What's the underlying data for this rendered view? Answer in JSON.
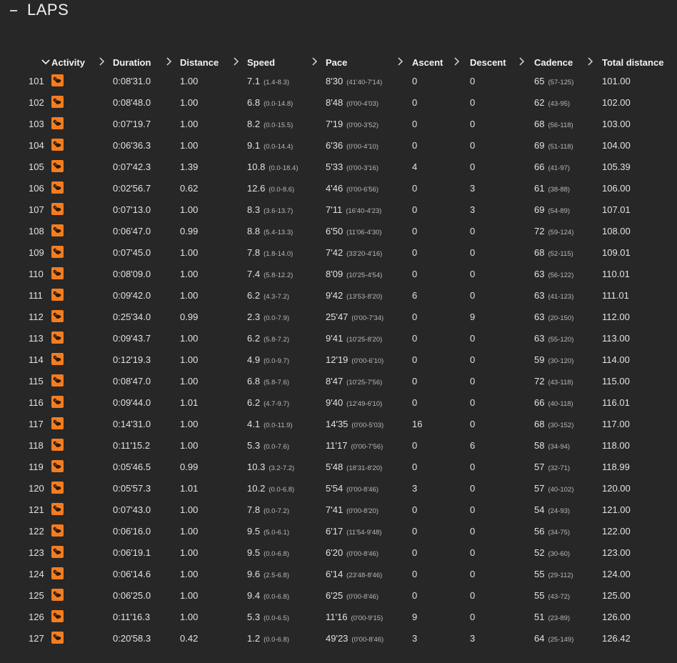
{
  "header": {
    "title": "LAPS"
  },
  "columns": [
    "Activity",
    "Duration",
    "Distance",
    "Speed",
    "Pace",
    "Ascent",
    "Descent",
    "Cadence",
    "Total distance"
  ],
  "laps": [
    {
      "n": "101",
      "dur": "0:08'31.0",
      "dist": "1.00",
      "spd": "7.1",
      "spd_r": "(1.4-8.3)",
      "pace": "8'30",
      "pace_r": "(41'40-7'14)",
      "asc": "0",
      "desc": "0",
      "cad": "65",
      "cad_r": "(57-125)",
      "tot": "101.00"
    },
    {
      "n": "102",
      "dur": "0:08'48.0",
      "dist": "1.00",
      "spd": "6.8",
      "spd_r": "(0.0-14.8)",
      "pace": "8'48",
      "pace_r": "(0'00-4'03)",
      "asc": "0",
      "desc": "0",
      "cad": "62",
      "cad_r": "(43-95)",
      "tot": "102.00"
    },
    {
      "n": "103",
      "dur": "0:07'19.7",
      "dist": "1.00",
      "spd": "8.2",
      "spd_r": "(0.0-15.5)",
      "pace": "7'19",
      "pace_r": "(0'00-3'52)",
      "asc": "0",
      "desc": "0",
      "cad": "68",
      "cad_r": "(56-118)",
      "tot": "103.00"
    },
    {
      "n": "104",
      "dur": "0:06'36.3",
      "dist": "1.00",
      "spd": "9.1",
      "spd_r": "(0.0-14.4)",
      "pace": "6'36",
      "pace_r": "(0'00-4'10)",
      "asc": "0",
      "desc": "0",
      "cad": "69",
      "cad_r": "(51-118)",
      "tot": "104.00"
    },
    {
      "n": "105",
      "dur": "0:07'42.3",
      "dist": "1.39",
      "spd": "10.8",
      "spd_r": "(0.0-18.4)",
      "pace": "5'33",
      "pace_r": "(0'00-3'16)",
      "asc": "4",
      "desc": "0",
      "cad": "66",
      "cad_r": "(41-97)",
      "tot": "105.39"
    },
    {
      "n": "106",
      "dur": "0:02'56.7",
      "dist": "0.62",
      "spd": "12.6",
      "spd_r": "(0.0-8.6)",
      "pace": "4'46",
      "pace_r": "(0'00-6'56)",
      "asc": "0",
      "desc": "3",
      "cad": "61",
      "cad_r": "(38-88)",
      "tot": "106.00"
    },
    {
      "n": "107",
      "dur": "0:07'13.0",
      "dist": "1.00",
      "spd": "8.3",
      "spd_r": "(3.6-13.7)",
      "pace": "7'11",
      "pace_r": "(16'40-4'23)",
      "asc": "0",
      "desc": "3",
      "cad": "69",
      "cad_r": "(54-89)",
      "tot": "107.01"
    },
    {
      "n": "108",
      "dur": "0:06'47.0",
      "dist": "0.99",
      "spd": "8.8",
      "spd_r": "(5.4-13.3)",
      "pace": "6'50",
      "pace_r": "(11'06-4'30)",
      "asc": "0",
      "desc": "0",
      "cad": "72",
      "cad_r": "(59-124)",
      "tot": "108.00"
    },
    {
      "n": "109",
      "dur": "0:07'45.0",
      "dist": "1.00",
      "spd": "7.8",
      "spd_r": "(1.8-14.0)",
      "pace": "7'42",
      "pace_r": "(33'20-4'16)",
      "asc": "0",
      "desc": "0",
      "cad": "68",
      "cad_r": "(52-115)",
      "tot": "109.01"
    },
    {
      "n": "110",
      "dur": "0:08'09.0",
      "dist": "1.00",
      "spd": "7.4",
      "spd_r": "(5.8-12.2)",
      "pace": "8'09",
      "pace_r": "(10'25-4'54)",
      "asc": "0",
      "desc": "0",
      "cad": "63",
      "cad_r": "(56-122)",
      "tot": "110.01"
    },
    {
      "n": "111",
      "dur": "0:09'42.0",
      "dist": "1.00",
      "spd": "6.2",
      "spd_r": "(4.3-7.2)",
      "pace": "9'42",
      "pace_r": "(13'53-8'20)",
      "asc": "6",
      "desc": "0",
      "cad": "63",
      "cad_r": "(41-123)",
      "tot": "111.01"
    },
    {
      "n": "112",
      "dur": "0:25'34.0",
      "dist": "0.99",
      "spd": "2.3",
      "spd_r": "(0.0-7.9)",
      "pace": "25'47",
      "pace_r": "(0'00-7'34)",
      "asc": "0",
      "desc": "9",
      "cad": "63",
      "cad_r": "(20-150)",
      "tot": "112.00"
    },
    {
      "n": "113",
      "dur": "0:09'43.7",
      "dist": "1.00",
      "spd": "6.2",
      "spd_r": "(5.8-7.2)",
      "pace": "9'41",
      "pace_r": "(10'25-8'20)",
      "asc": "0",
      "desc": "0",
      "cad": "63",
      "cad_r": "(55-120)",
      "tot": "113.00"
    },
    {
      "n": "114",
      "dur": "0:12'19.3",
      "dist": "1.00",
      "spd": "4.9",
      "spd_r": "(0.0-9.7)",
      "pace": "12'19",
      "pace_r": "(0'00-6'10)",
      "asc": "0",
      "desc": "0",
      "cad": "59",
      "cad_r": "(30-120)",
      "tot": "114.00"
    },
    {
      "n": "115",
      "dur": "0:08'47.0",
      "dist": "1.00",
      "spd": "6.8",
      "spd_r": "(5.8-7.6)",
      "pace": "8'47",
      "pace_r": "(10'25-7'56)",
      "asc": "0",
      "desc": "0",
      "cad": "72",
      "cad_r": "(43-118)",
      "tot": "115.00"
    },
    {
      "n": "116",
      "dur": "0:09'44.0",
      "dist": "1.01",
      "spd": "6.2",
      "spd_r": "(4.7-9.7)",
      "pace": "9'40",
      "pace_r": "(12'49-6'10)",
      "asc": "0",
      "desc": "0",
      "cad": "66",
      "cad_r": "(40-118)",
      "tot": "116.01"
    },
    {
      "n": "117",
      "dur": "0:14'31.0",
      "dist": "1.00",
      "spd": "4.1",
      "spd_r": "(0.0-11.9)",
      "pace": "14'35",
      "pace_r": "(0'00-5'03)",
      "asc": "16",
      "desc": "0",
      "cad": "68",
      "cad_r": "(30-152)",
      "tot": "117.00"
    },
    {
      "n": "118",
      "dur": "0:11'15.2",
      "dist": "1.00",
      "spd": "5.3",
      "spd_r": "(0.0-7.6)",
      "pace": "11'17",
      "pace_r": "(0'00-7'56)",
      "asc": "0",
      "desc": "6",
      "cad": "58",
      "cad_r": "(34-94)",
      "tot": "118.00"
    },
    {
      "n": "119",
      "dur": "0:05'46.5",
      "dist": "0.99",
      "spd": "10.3",
      "spd_r": "(3.2-7.2)",
      "pace": "5'48",
      "pace_r": "(18'31-8'20)",
      "asc": "0",
      "desc": "0",
      "cad": "57",
      "cad_r": "(32-71)",
      "tot": "118.99"
    },
    {
      "n": "120",
      "dur": "0:05'57.3",
      "dist": "1.01",
      "spd": "10.2",
      "spd_r": "(0.0-6.8)",
      "pace": "5'54",
      "pace_r": "(0'00-8'46)",
      "asc": "3",
      "desc": "0",
      "cad": "57",
      "cad_r": "(40-102)",
      "tot": "120.00"
    },
    {
      "n": "121",
      "dur": "0:07'43.0",
      "dist": "1.00",
      "spd": "7.8",
      "spd_r": "(0.0-7.2)",
      "pace": "7'41",
      "pace_r": "(0'00-8'20)",
      "asc": "0",
      "desc": "0",
      "cad": "54",
      "cad_r": "(24-93)",
      "tot": "121.00"
    },
    {
      "n": "122",
      "dur": "0:06'16.0",
      "dist": "1.00",
      "spd": "9.5",
      "spd_r": "(5.0-6.1)",
      "pace": "6'17",
      "pace_r": "(11'54-9'48)",
      "asc": "0",
      "desc": "0",
      "cad": "56",
      "cad_r": "(34-75)",
      "tot": "122.00"
    },
    {
      "n": "123",
      "dur": "0:06'19.1",
      "dist": "1.00",
      "spd": "9.5",
      "spd_r": "(0.0-6.8)",
      "pace": "6'20",
      "pace_r": "(0'00-8'46)",
      "asc": "0",
      "desc": "0",
      "cad": "52",
      "cad_r": "(30-60)",
      "tot": "123.00"
    },
    {
      "n": "124",
      "dur": "0:06'14.6",
      "dist": "1.00",
      "spd": "9.6",
      "spd_r": "(2.5-6.8)",
      "pace": "6'14",
      "pace_r": "(23'48-8'46)",
      "asc": "0",
      "desc": "0",
      "cad": "55",
      "cad_r": "(29-112)",
      "tot": "124.00"
    },
    {
      "n": "125",
      "dur": "0:06'25.0",
      "dist": "1.00",
      "spd": "9.4",
      "spd_r": "(0.0-6.8)",
      "pace": "6'25",
      "pace_r": "(0'00-8'46)",
      "asc": "0",
      "desc": "0",
      "cad": "55",
      "cad_r": "(43-72)",
      "tot": "125.00"
    },
    {
      "n": "126",
      "dur": "0:11'16.3",
      "dist": "1.00",
      "spd": "5.3",
      "spd_r": "(0.0-6.5)",
      "pace": "11'16",
      "pace_r": "(0'00-9'15)",
      "asc": "9",
      "desc": "0",
      "cad": "51",
      "cad_r": "(23-89)",
      "tot": "126.00"
    },
    {
      "n": "127",
      "dur": "0:20'58.3",
      "dist": "0.42",
      "spd": "1.2",
      "spd_r": "(0.0-6.8)",
      "pace": "49'23",
      "pace_r": "(0'00-8'46)",
      "asc": "3",
      "desc": "3",
      "cad": "64",
      "cad_r": "(25-149)",
      "tot": "126.42"
    }
  ],
  "icons": {
    "activity": "running-shoe-icon",
    "expand": "chevron-down-icon",
    "column_menu": "chevron-right-icon"
  },
  "colors": {
    "accent": "#f47d20",
    "background": "#272727"
  }
}
